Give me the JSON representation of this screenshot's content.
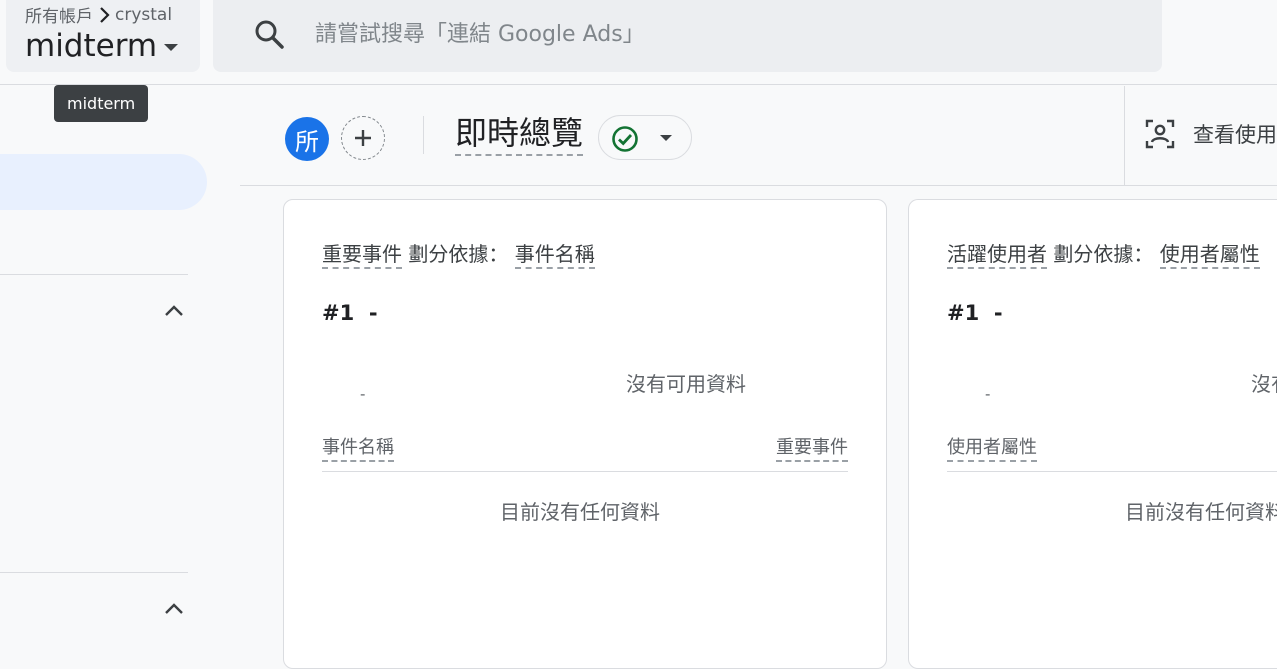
{
  "header": {
    "breadcrumb_account": "所有帳戶",
    "breadcrumb_separator_icon": "chevron-right-icon",
    "breadcrumb_property": "crystal",
    "property_name": "midterm",
    "tooltip": "midterm",
    "search_placeholder": "請嘗試搜尋「連結 Google Ads」"
  },
  "report": {
    "comparison_avatar": "所",
    "title": "即時總覽",
    "status_icon": "check-circle-icon",
    "user_snapshot_label": "查看使用"
  },
  "cards": [
    {
      "metric": "重要事件",
      "breakdown_label": "劃分依據：",
      "dimension": "事件名稱",
      "rank": "#1",
      "rank_value": "-",
      "value_placeholder": "-",
      "no_data": "沒有可用資料",
      "column_dimension": "事件名稱",
      "column_metric": "重要事件",
      "empty_message": "目前沒有任何資料"
    },
    {
      "metric": "活躍使用者",
      "breakdown_label": "劃分依據：",
      "dimension": "使用者屬性",
      "rank": "#1",
      "rank_value": "-",
      "value_placeholder": "-",
      "no_data": "沒有可用資料",
      "column_dimension": "使用者屬性",
      "column_metric": "",
      "empty_message": "目前沒有任何資料"
    }
  ],
  "colors": {
    "accent": "#1a73e8",
    "success": "#137333",
    "nav_active": "#e8f0fe"
  }
}
